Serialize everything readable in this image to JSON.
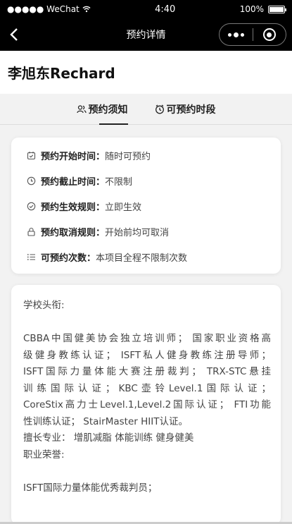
{
  "status_bar": {
    "carrier": "●●●●● WeChat",
    "time": "4:40",
    "battery": "100%"
  },
  "nav": {
    "title": "预约详情"
  },
  "coach": {
    "name": "李旭东Rechard"
  },
  "tabs": [
    {
      "label": "预约须知",
      "icon": "people-icon",
      "active": true
    },
    {
      "label": "可预约时段",
      "icon": "clock-icon",
      "active": false
    }
  ],
  "rules": [
    {
      "icon": "calendar-check-icon",
      "label": "预约开始时间：",
      "value": "随时可预约"
    },
    {
      "icon": "clock-icon",
      "label": "预约截止时间：",
      "value": "不限制"
    },
    {
      "icon": "check-circle-icon",
      "label": "预约生效规则：",
      "value": "立即生效"
    },
    {
      "icon": "lock-icon",
      "label": "预约取消规则：",
      "value": "开始前均可取消"
    },
    {
      "icon": "list-icon",
      "label": "可预约次数：",
      "value": "本项目全程不限制次数"
    }
  ],
  "bio": {
    "heading": "学校头衔:",
    "lines": [
      "CBBA中国健美协会独立培训师； 国家职业资格高",
      "级健身教练认证； ISFT私人健身教练注册导师；",
      "ISFT国际力量体能大赛注册裁判； TRX-STC悬挂",
      "训 练 国 际 认 证 ；  KBC 壶 铃 Level.1 国 际 认 证 ；",
      "CoreStix高力士Level.1,Level.2国际认证； FTI功能",
      "性训练认证； StairMaster HIIT认证。"
    ],
    "specialty": "擅长专业： 增肌减脂 体能训练 健身健美",
    "honors_heading": "职业荣誉:",
    "honor_line": "ISFT国际力量体能优秀裁判员；"
  }
}
